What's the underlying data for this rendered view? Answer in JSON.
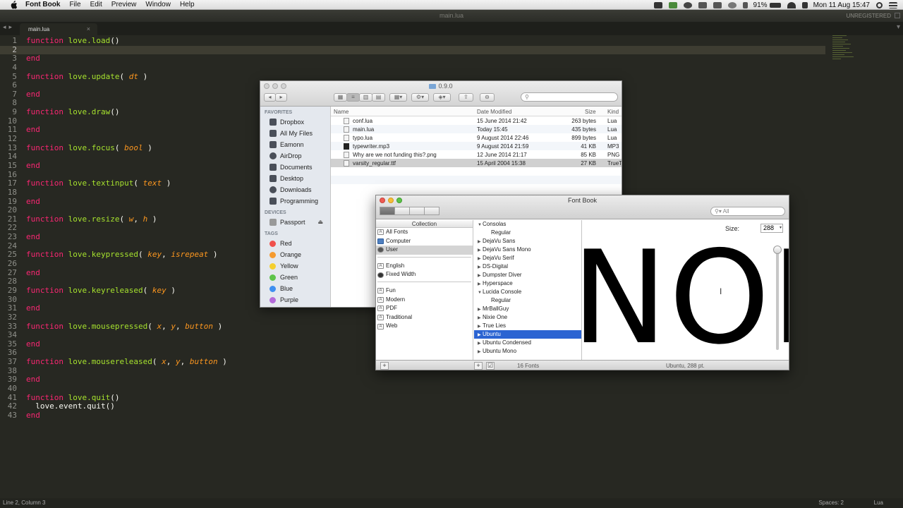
{
  "menubar": {
    "app_name": "Font Book",
    "menus": [
      "File",
      "Edit",
      "Preview",
      "Window",
      "Help"
    ],
    "battery": "91%",
    "clock": "Mon 11 Aug  15:47"
  },
  "editor": {
    "window_title": "main.lua",
    "unregistered": "UNREGISTERED",
    "tab_label": "main.lua",
    "lines": [
      {
        "n": "1",
        "t": [
          {
            "k": "kw",
            "s": "function "
          },
          {
            "k": "fn",
            "s": "love.load"
          },
          {
            "k": "tx",
            "s": "()"
          }
        ]
      },
      {
        "n": "2",
        "t": []
      },
      {
        "n": "3",
        "t": [
          {
            "k": "kw",
            "s": "end"
          }
        ]
      },
      {
        "n": "4",
        "t": []
      },
      {
        "n": "5",
        "t": [
          {
            "k": "kw",
            "s": "function "
          },
          {
            "k": "fn",
            "s": "love.update"
          },
          {
            "k": "tx",
            "s": "( "
          },
          {
            "k": "pa",
            "s": "dt"
          },
          {
            "k": "tx",
            "s": " )"
          }
        ]
      },
      {
        "n": "6",
        "t": []
      },
      {
        "n": "7",
        "t": [
          {
            "k": "kw",
            "s": "end"
          }
        ]
      },
      {
        "n": "8",
        "t": []
      },
      {
        "n": "9",
        "t": [
          {
            "k": "kw",
            "s": "function "
          },
          {
            "k": "fn",
            "s": "love.draw"
          },
          {
            "k": "tx",
            "s": "()"
          }
        ]
      },
      {
        "n": "10",
        "t": []
      },
      {
        "n": "11",
        "t": [
          {
            "k": "kw",
            "s": "end"
          }
        ]
      },
      {
        "n": "12",
        "t": []
      },
      {
        "n": "13",
        "t": [
          {
            "k": "kw",
            "s": "function "
          },
          {
            "k": "fn",
            "s": "love.focus"
          },
          {
            "k": "tx",
            "s": "( "
          },
          {
            "k": "pa",
            "s": "bool"
          },
          {
            "k": "tx",
            "s": " )"
          }
        ]
      },
      {
        "n": "14",
        "t": []
      },
      {
        "n": "15",
        "t": [
          {
            "k": "kw",
            "s": "end"
          }
        ]
      },
      {
        "n": "16",
        "t": []
      },
      {
        "n": "17",
        "t": [
          {
            "k": "kw",
            "s": "function "
          },
          {
            "k": "fn",
            "s": "love.textinput"
          },
          {
            "k": "tx",
            "s": "( "
          },
          {
            "k": "pa",
            "s": "text"
          },
          {
            "k": "tx",
            "s": " )"
          }
        ]
      },
      {
        "n": "18",
        "t": []
      },
      {
        "n": "19",
        "t": [
          {
            "k": "kw",
            "s": "end"
          }
        ]
      },
      {
        "n": "20",
        "t": []
      },
      {
        "n": "21",
        "t": [
          {
            "k": "kw",
            "s": "function "
          },
          {
            "k": "fn",
            "s": "love.resize"
          },
          {
            "k": "tx",
            "s": "( "
          },
          {
            "k": "pa",
            "s": "w"
          },
          {
            "k": "tx",
            "s": ", "
          },
          {
            "k": "pa",
            "s": "h"
          },
          {
            "k": "tx",
            "s": " )"
          }
        ]
      },
      {
        "n": "22",
        "t": []
      },
      {
        "n": "23",
        "t": [
          {
            "k": "kw",
            "s": "end"
          }
        ]
      },
      {
        "n": "24",
        "t": []
      },
      {
        "n": "25",
        "t": [
          {
            "k": "kw",
            "s": "function "
          },
          {
            "k": "fn",
            "s": "love.keypressed"
          },
          {
            "k": "tx",
            "s": "( "
          },
          {
            "k": "pa",
            "s": "key"
          },
          {
            "k": "tx",
            "s": ", "
          },
          {
            "k": "pa",
            "s": "isrepeat"
          },
          {
            "k": "tx",
            "s": " )"
          }
        ]
      },
      {
        "n": "26",
        "t": []
      },
      {
        "n": "27",
        "t": [
          {
            "k": "kw",
            "s": "end"
          }
        ]
      },
      {
        "n": "28",
        "t": []
      },
      {
        "n": "29",
        "t": [
          {
            "k": "kw",
            "s": "function "
          },
          {
            "k": "fn",
            "s": "love.keyreleased"
          },
          {
            "k": "tx",
            "s": "( "
          },
          {
            "k": "pa",
            "s": "key"
          },
          {
            "k": "tx",
            "s": " )"
          }
        ]
      },
      {
        "n": "30",
        "t": []
      },
      {
        "n": "31",
        "t": [
          {
            "k": "kw",
            "s": "end"
          }
        ]
      },
      {
        "n": "32",
        "t": []
      },
      {
        "n": "33",
        "t": [
          {
            "k": "kw",
            "s": "function "
          },
          {
            "k": "fn",
            "s": "love.mousepressed"
          },
          {
            "k": "tx",
            "s": "( "
          },
          {
            "k": "pa",
            "s": "x"
          },
          {
            "k": "tx",
            "s": ", "
          },
          {
            "k": "pa",
            "s": "y"
          },
          {
            "k": "tx",
            "s": ", "
          },
          {
            "k": "pa",
            "s": "button"
          },
          {
            "k": "tx",
            "s": " )"
          }
        ]
      },
      {
        "n": "34",
        "t": []
      },
      {
        "n": "35",
        "t": [
          {
            "k": "kw",
            "s": "end"
          }
        ]
      },
      {
        "n": "36",
        "t": []
      },
      {
        "n": "37",
        "t": [
          {
            "k": "kw",
            "s": "function "
          },
          {
            "k": "fn",
            "s": "love.mousereleased"
          },
          {
            "k": "tx",
            "s": "( "
          },
          {
            "k": "pa",
            "s": "x"
          },
          {
            "k": "tx",
            "s": ", "
          },
          {
            "k": "pa",
            "s": "y"
          },
          {
            "k": "tx",
            "s": ", "
          },
          {
            "k": "pa",
            "s": "button"
          },
          {
            "k": "tx",
            "s": " )"
          }
        ]
      },
      {
        "n": "38",
        "t": []
      },
      {
        "n": "39",
        "t": [
          {
            "k": "kw",
            "s": "end"
          }
        ]
      },
      {
        "n": "40",
        "t": []
      },
      {
        "n": "41",
        "t": [
          {
            "k": "kw",
            "s": "function "
          },
          {
            "k": "fn",
            "s": "love.quit"
          },
          {
            "k": "tx",
            "s": "()"
          }
        ]
      },
      {
        "n": "42",
        "t": [
          {
            "k": "tx",
            "s": "  love.event.quit()"
          }
        ]
      },
      {
        "n": "43",
        "t": [
          {
            "k": "kw",
            "s": "end"
          }
        ]
      }
    ],
    "current_line": 2,
    "status_left": "Line 2, Column 3",
    "status_spaces": "Spaces: 2",
    "status_syntax": "Lua"
  },
  "finder": {
    "title": "0.9.0",
    "sidebar": {
      "favorites_header": "FAVORITES",
      "favorites": [
        "Dropbox",
        "All My Files",
        "Eamonn",
        "AirDrop",
        "Documents",
        "Desktop",
        "Downloads",
        "Programming"
      ],
      "devices_header": "DEVICES",
      "devices": [
        "Passport"
      ],
      "tags_header": "TAGS",
      "tags": [
        {
          "label": "Red",
          "color": "#f0504c"
        },
        {
          "label": "Orange",
          "color": "#f59a2f"
        },
        {
          "label": "Yellow",
          "color": "#f5cf2f"
        },
        {
          "label": "Green",
          "color": "#5dc44a"
        },
        {
          "label": "Blue",
          "color": "#3f8ff0"
        },
        {
          "label": "Purple",
          "color": "#b36ad9"
        }
      ]
    },
    "columns": {
      "name": "Name",
      "date": "Date Modified",
      "size": "Size",
      "kind": "Kind"
    },
    "files": [
      {
        "name": "conf.lua",
        "date": "15 June 2014 21:42",
        "size": "263 bytes",
        "kind": "Lua"
      },
      {
        "name": "main.lua",
        "date": "Today 15:45",
        "size": "435 bytes",
        "kind": "Lua"
      },
      {
        "name": "typo.lua",
        "date": "9 August 2014 22:46",
        "size": "899 bytes",
        "kind": "Lua"
      },
      {
        "name": "typewriter.mp3",
        "date": "9 August 2014 21:59",
        "size": "41 KB",
        "kind": "MP3"
      },
      {
        "name": "Why are we not funding this?.png",
        "date": "12 June 2014 21:17",
        "size": "85 KB",
        "kind": "PNG"
      },
      {
        "name": "varsity_regular.ttf",
        "date": "15 April 2004 15:38",
        "size": "27 KB",
        "kind": "TrueT"
      }
    ]
  },
  "fontbook": {
    "title": "Font Book",
    "search_placeholder": "All",
    "collection_header": "Collection",
    "collections_top": [
      "All Fonts",
      "Computer",
      "User"
    ],
    "collections_mid": [
      "English",
      "Fixed Width"
    ],
    "collections_bottom": [
      "Fun",
      "Modern",
      "PDF",
      "Traditional",
      "Web"
    ],
    "families": [
      {
        "label": "Consolas",
        "tri": "▼",
        "sub": false
      },
      {
        "label": "Regular",
        "tri": "",
        "sub": true
      },
      {
        "label": "DejaVu Sans",
        "tri": "▶",
        "sub": false
      },
      {
        "label": "DejaVu Sans Mono",
        "tri": "▶",
        "sub": false
      },
      {
        "label": "DejaVu Serif",
        "tri": "▶",
        "sub": false
      },
      {
        "label": "DS-Digital",
        "tri": "▶",
        "sub": false
      },
      {
        "label": "Dumpster Diver",
        "tri": "▶",
        "sub": false
      },
      {
        "label": "Hyperspace",
        "tri": "▶",
        "sub": false
      },
      {
        "label": "Lucida Console",
        "tri": "▼",
        "sub": false
      },
      {
        "label": "Regular",
        "tri": "",
        "sub": true
      },
      {
        "label": "MrBallGuy",
        "tri": "▶",
        "sub": false
      },
      {
        "label": "Nixie One",
        "tri": "▶",
        "sub": false
      },
      {
        "label": "True Lies",
        "tri": "▶",
        "sub": false
      },
      {
        "label": "Ubuntu",
        "tri": "▶",
        "sub": false,
        "selected": true
      },
      {
        "label": "Ubuntu Condensed",
        "tri": "▶",
        "sub": false
      },
      {
        "label": "Ubuntu Mono",
        "tri": "▶",
        "sub": false
      }
    ],
    "size_label": "Size:",
    "size_value": "288",
    "preview_text": "NOF",
    "font_count": "16 Fonts",
    "font_info": "Ubuntu, 288 pt."
  }
}
